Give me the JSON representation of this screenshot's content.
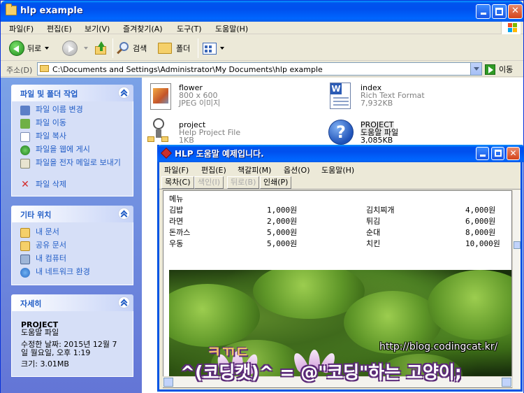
{
  "window": {
    "title": "hlp example",
    "menu": [
      "파일(F)",
      "편집(E)",
      "보기(V)",
      "즐겨찾기(A)",
      "도구(T)",
      "도움말(H)"
    ]
  },
  "toolbar": {
    "back_label": "뒤로",
    "search_label": "검색",
    "folders_label": "폴더"
  },
  "address": {
    "label": "주소(D)",
    "path": "C:\\Documents and Settings\\Administrator\\My Documents\\hlp example",
    "go_label": "이동"
  },
  "taskpane": {
    "file_tasks": {
      "title": "파일 및 폴더 작업",
      "items": [
        "파일 이름 변경",
        "파일 이동",
        "파일 복사",
        "파일을 웹에 게시",
        "파일을 전자 메일로 보내기",
        "파일 삭제"
      ]
    },
    "other_places": {
      "title": "기타 위치",
      "items": [
        "내 문서",
        "공유 문서",
        "내 컴퓨터",
        "내 네트워크 환경"
      ]
    },
    "details": {
      "title": "자세히",
      "name": "PROJECT",
      "type": "도움말 파일",
      "modified_1": "수정한 날짜: 2015년 12월 7",
      "modified_2": "일 월요일, 오후 1:19",
      "size": "크기: 3.01MB"
    }
  },
  "files": [
    {
      "name": "flower",
      "line2": "800 x 600",
      "line3": "JPEG 이미지",
      "icon": "jpeg-image-icon"
    },
    {
      "name": "index",
      "line2": "Rich Text Format",
      "line3": "7,932KB",
      "icon": "word-document-icon"
    },
    {
      "name": "project",
      "line2": "Help Project File",
      "line3": "1KB",
      "icon": "help-project-icon"
    },
    {
      "name": "PROJECT",
      "line2": "도움말 파일",
      "line3": "3,085KB",
      "icon": "help-file-icon"
    }
  ],
  "hlp": {
    "title": "HLP 도움말 예제입니다.",
    "menu": [
      "파일(F)",
      "편집(E)",
      "책갈피(M)",
      "옵션(O)",
      "도움말(H)"
    ],
    "buttons": [
      "목차(C)",
      "색인(I)",
      "뒤로(B)",
      "인쇄(P)"
    ],
    "heading": "메뉴",
    "rows": [
      [
        "김밥",
        "1,000원",
        "김치찌개",
        "4,000원"
      ],
      [
        "라면",
        "2,000원",
        "튀김",
        "6,000원"
      ],
      [
        "돈까스",
        "5,000원",
        "순대",
        "8,000원"
      ],
      [
        "우동",
        "5,000원",
        "치킨",
        "10,000원"
      ]
    ]
  },
  "watermark": {
    "small": "ㅋㄲㄷ",
    "url": "http://blog.codingcat.kr/",
    "line": "^(코딩캣)^ = @\"코딩\"하는 고양이;"
  }
}
